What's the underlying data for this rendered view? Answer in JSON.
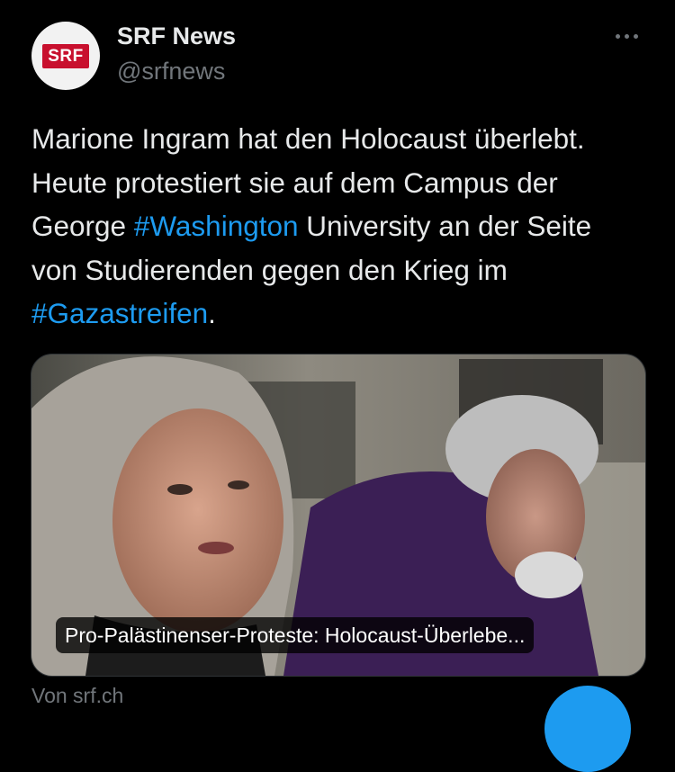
{
  "account": {
    "avatar_text": "SRF",
    "display_name": "SRF News",
    "handle": "@srfnews"
  },
  "tweet": {
    "text_1": "Marione Ingram hat den Holocaust überlebt. Heute protestiert sie auf dem Campus der George ",
    "hashtag_1": "#Washington",
    "text_2": " University an der Seite von Studierenden gegen den Krieg im ",
    "hashtag_2": "#Gazastreifen",
    "text_3": "."
  },
  "media": {
    "caption": "Pro-Palästinenser-Proteste: Holocaust-Überlebe..."
  },
  "link_source": "Von srf.ch",
  "icons": {
    "more": "more-horizontal-icon",
    "compose": "compose-fab"
  },
  "colors": {
    "background": "#000000",
    "text": "#e7e9ea",
    "secondary": "#71767b",
    "accent": "#1d9bf0",
    "brand": "#c8102e"
  }
}
